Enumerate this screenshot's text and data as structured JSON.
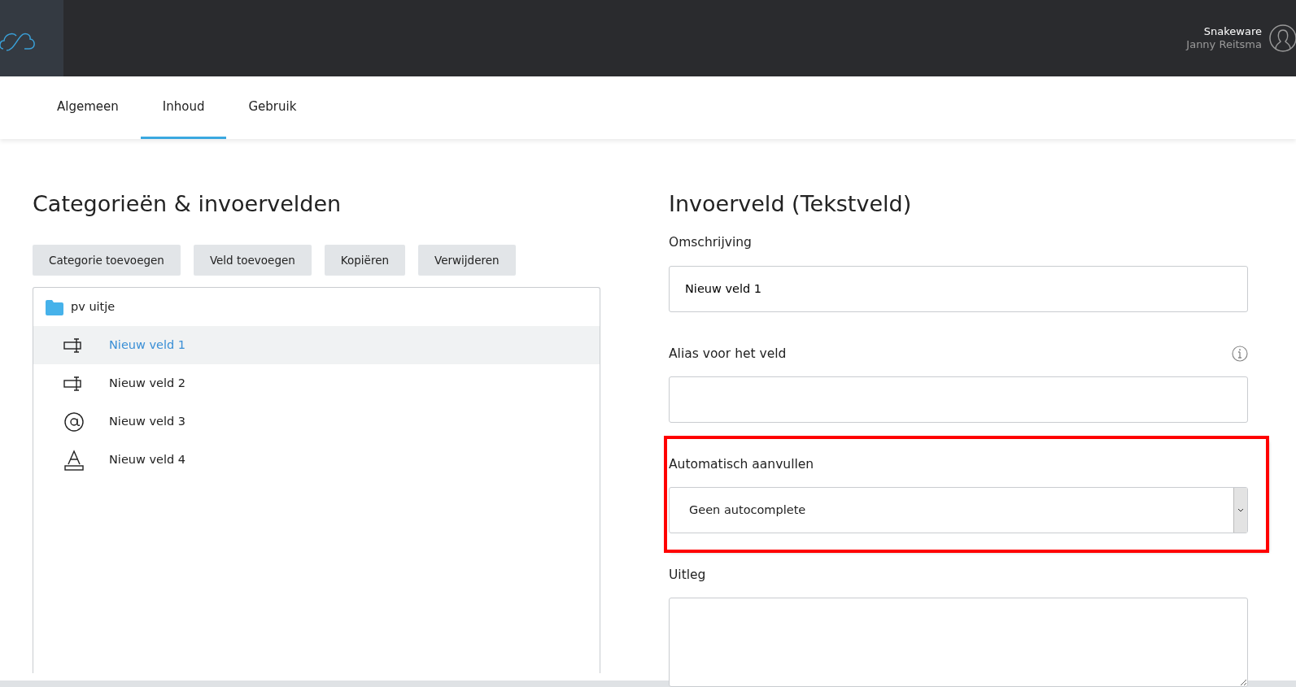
{
  "user": {
    "organization": "Snakeware",
    "name": "Janny Reitsma"
  },
  "tabs": [
    {
      "label": "Algemeen",
      "selected": false
    },
    {
      "label": "Inhoud",
      "selected": true
    },
    {
      "label": "Gebruik",
      "selected": false
    }
  ],
  "left": {
    "title": "Categorieën & invoervelden",
    "buttons": [
      "Categorie toevoegen",
      "Veld toevoegen",
      "Kopiëren",
      "Verwijderen"
    ],
    "tree": [
      {
        "label": "pv uitje",
        "kind": "folder",
        "children": [
          {
            "label": "Nieuw veld 1",
            "kind": "textfield",
            "selected": true
          },
          {
            "label": "Nieuw veld 2",
            "kind": "textfield",
            "selected": false
          },
          {
            "label": "Nieuw veld 3",
            "kind": "email",
            "selected": false
          },
          {
            "label": "Nieuw veld 4",
            "kind": "textarea",
            "selected": false
          }
        ]
      }
    ]
  },
  "right": {
    "title": "Invoerveld (Tekstveld)",
    "fields": [
      {
        "label": "Omschrijving",
        "kind": "text",
        "value": "Nieuw veld 1",
        "info": false,
        "highlighted": false
      },
      {
        "label": "Alias voor het veld",
        "kind": "text",
        "info": true,
        "highlighted": false
      },
      {
        "label": "Automatisch aanvullen",
        "kind": "select",
        "value": "Geen autocomplete",
        "info": false,
        "highlighted": true
      },
      {
        "label": "Uitleg",
        "kind": "textarea",
        "info": false,
        "highlighted": false
      }
    ]
  }
}
